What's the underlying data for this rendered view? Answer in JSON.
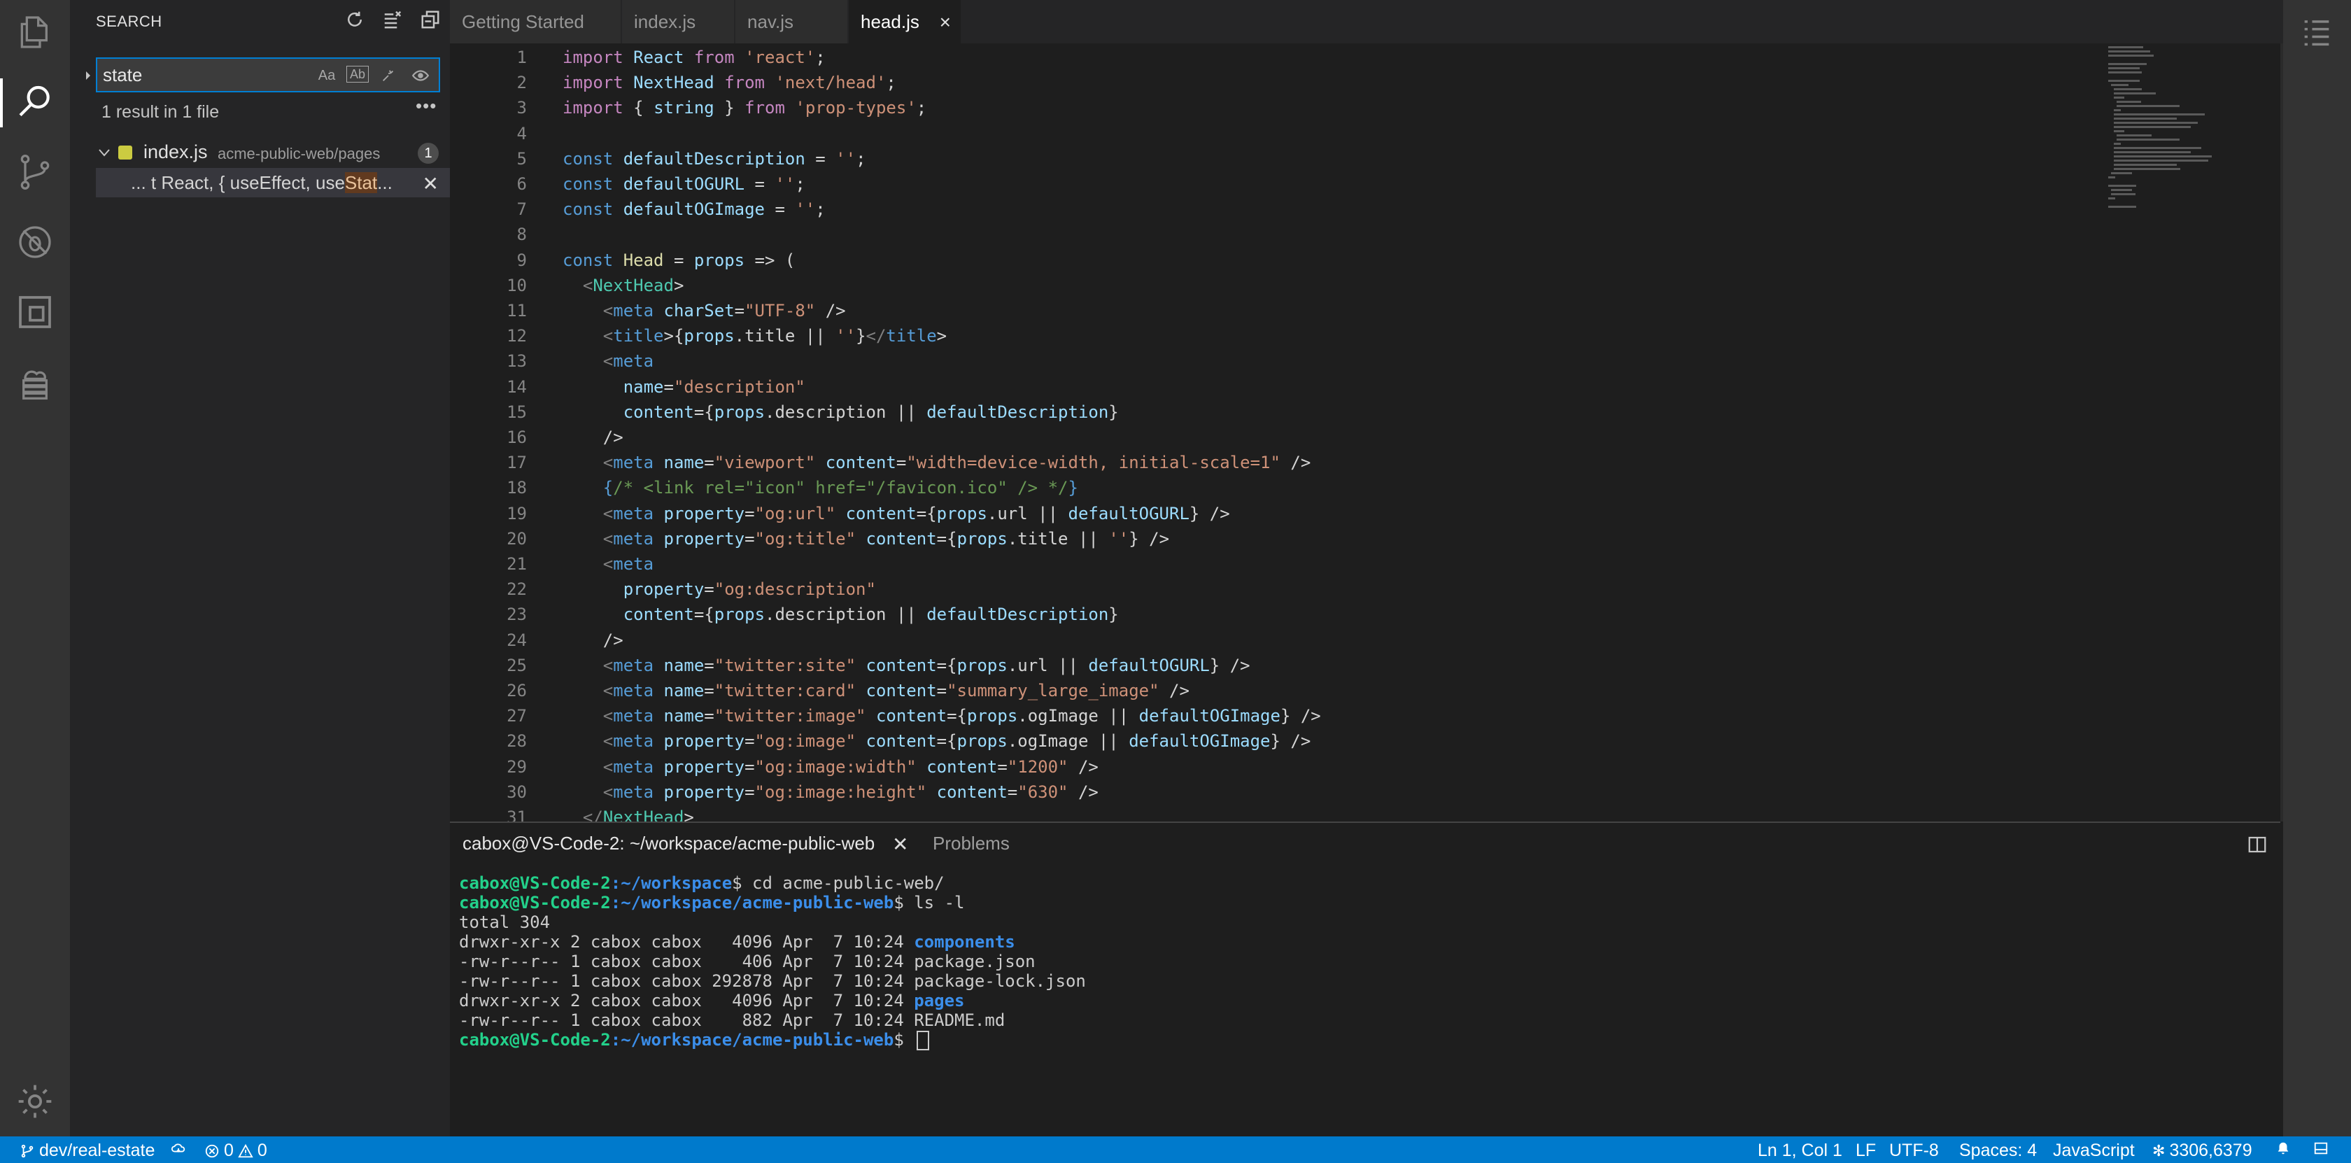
{
  "activity_bar": {
    "icons": [
      "files-icon",
      "search-icon",
      "source-control-icon",
      "debug-icon",
      "extensions-icon",
      "remote-explorer-icon",
      "settings-gear-icon"
    ]
  },
  "sidebar": {
    "title": "SEARCH",
    "search_value": "state",
    "option_match_case": "Aa",
    "option_whole_word": "Ab",
    "result_count": "1 result in 1 file",
    "result_file": {
      "name": "index.js",
      "path": "acme-public-web/pages",
      "count": "1",
      "match_prefix": "... t React, { useEffect, use",
      "match_hit": "Stat",
      "match_suffix": "..."
    }
  },
  "tabs": [
    {
      "label": "Getting Started"
    },
    {
      "label": "index.js"
    },
    {
      "label": "nav.js"
    },
    {
      "label": "head.js",
      "close": "×"
    }
  ],
  "editor": {
    "lines": [
      {
        "n": "1",
        "t": "import React from 'react';"
      },
      {
        "n": "2",
        "t": "import NextHead from 'next/head';"
      },
      {
        "n": "3",
        "t": "import { string } from 'prop-types';"
      },
      {
        "n": "4",
        "t": ""
      },
      {
        "n": "5",
        "t": "const defaultDescription = '';"
      },
      {
        "n": "6",
        "t": "const defaultOGURL = '';"
      },
      {
        "n": "7",
        "t": "const defaultOGImage = '';"
      },
      {
        "n": "8",
        "t": ""
      },
      {
        "n": "9",
        "t": "const Head = props => ("
      },
      {
        "n": "10",
        "t": "  <NextHead>"
      },
      {
        "n": "11",
        "t": "    <meta charSet=\"UTF-8\" />"
      },
      {
        "n": "12",
        "t": "    <title>{props.title || ''}</title>"
      },
      {
        "n": "13",
        "t": "    <meta"
      },
      {
        "n": "14",
        "t": "      name=\"description\""
      },
      {
        "n": "15",
        "t": "      content={props.description || defaultDescription}"
      },
      {
        "n": "16",
        "t": "    />"
      },
      {
        "n": "17",
        "t": "    <meta name=\"viewport\" content=\"width=device-width, initial-scale=1\" />"
      },
      {
        "n": "18",
        "t": "    {/* <link rel=\"icon\" href=\"/favicon.ico\" /> */}"
      },
      {
        "n": "19",
        "t": "    <meta property=\"og:url\" content={props.url || defaultOGURL} />"
      },
      {
        "n": "20",
        "t": "    <meta property=\"og:title\" content={props.title || ''} />"
      },
      {
        "n": "21",
        "t": "    <meta"
      },
      {
        "n": "22",
        "t": "      property=\"og:description\""
      },
      {
        "n": "23",
        "t": "      content={props.description || defaultDescription}"
      },
      {
        "n": "24",
        "t": "    />"
      },
      {
        "n": "25",
        "t": "    <meta name=\"twitter:site\" content={props.url || defaultOGURL} />"
      },
      {
        "n": "26",
        "t": "    <meta name=\"twitter:card\" content=\"summary_large_image\" />"
      },
      {
        "n": "27",
        "t": "    <meta name=\"twitter:image\" content={props.ogImage || defaultOGImage} />"
      },
      {
        "n": "28",
        "t": "    <meta property=\"og:image\" content={props.ogImage || defaultOGImage} />"
      },
      {
        "n": "29",
        "t": "    <meta property=\"og:image:width\" content=\"1200\" />"
      },
      {
        "n": "30",
        "t": "    <meta property=\"og:image:height\" content=\"630\" />"
      },
      {
        "n": "31",
        "t": "  </NextHead>"
      }
    ]
  },
  "panel": {
    "terminal_tab": "cabox@VS-Code-2: ~/workspace/acme-public-web",
    "problems_tab": "Problems",
    "prompt_user": "cabox@VS-Code-2",
    "terminal": {
      "l1_path": ":~/workspace",
      "l1_cmd": "$ cd acme-public-web/",
      "l2_path": ":~/workspace/acme-public-web",
      "l2_cmd": "$ ls -l",
      "total": "total 304",
      "rows": [
        {
          "meta": "drwxr-xr-x 2 cabox cabox   4096 Apr  7 10:24 ",
          "name": "components"
        },
        {
          "meta": "-rw-r--r-- 1 cabox cabox    406 Apr  7 10:24 ",
          "name": "package.json"
        },
        {
          "meta": "-rw-r--r-- 1 cabox cabox 292878 Apr  7 10:24 ",
          "name": "package-lock.json"
        },
        {
          "meta": "drwxr-xr-x 2 cabox cabox   4096 Apr  7 10:24 ",
          "name": "pages"
        },
        {
          "meta": "-rw-r--r-- 1 cabox cabox    882 Apr  7 10:24 ",
          "name": "README.md"
        }
      ],
      "l3_path": ":~/workspace/acme-public-web",
      "l3_cmd": "$ "
    }
  },
  "statusbar": {
    "branch": "dev/real-estate",
    "errors": "0",
    "warnings": "0",
    "position": "Ln 1, Col 1",
    "eol": "LF",
    "encoding": "UTF-8",
    "spaces": "Spaces: 4",
    "language": "JavaScript",
    "coords": "3306,6379"
  },
  "colors": {
    "accent": "#007acc",
    "sidebar_bg": "#252526",
    "editor_bg": "#1e1e1e",
    "terminal_prompt_user": "#23d18b",
    "terminal_prompt_path": "#3b8eea"
  }
}
